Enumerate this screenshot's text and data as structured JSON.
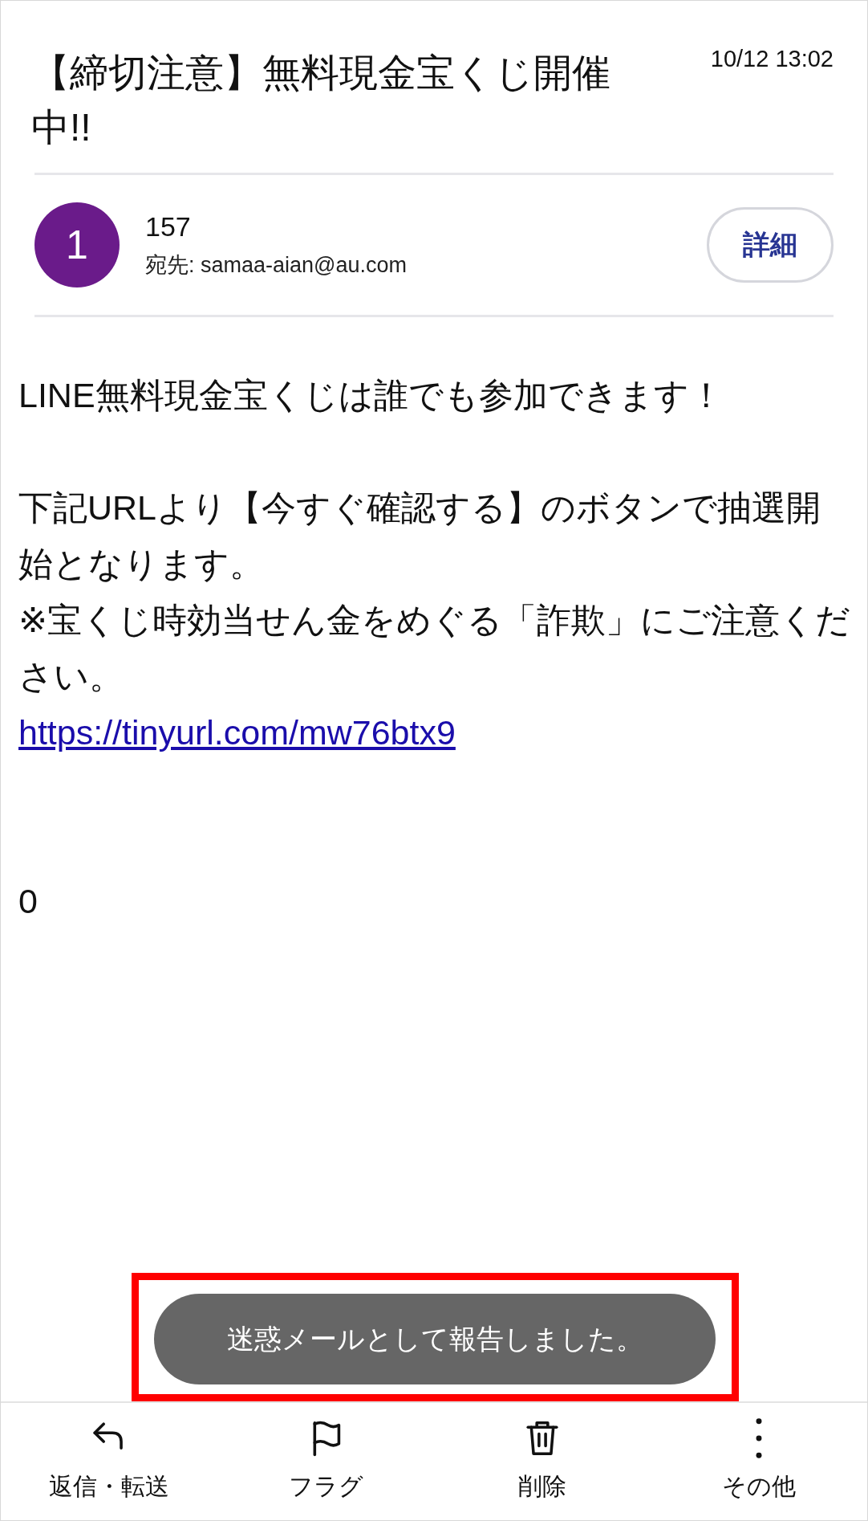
{
  "header": {
    "subject": "【締切注意】無料現金宝くじ開催中!!",
    "date": "10/12 13:02"
  },
  "sender": {
    "avatar": "1",
    "name": "157",
    "recipient": "宛先: samaa-aian@au.com",
    "details_button": "詳細"
  },
  "body": [
    {
      "kind": "text",
      "text": "LINE無料現金宝くじは誰でも参加できます！"
    },
    {
      "kind": "blank"
    },
    {
      "kind": "text",
      "text": "下記URLより【今すぐ確認する】のボタンで抽選開始となります。"
    },
    {
      "kind": "text",
      "text": "※宝くじ時効当せん金をめぐる「詐欺」にご注意ください。"
    },
    {
      "kind": "link",
      "text": "https://tinyurl.com/mw76btx9"
    },
    {
      "kind": "blank"
    },
    {
      "kind": "blank"
    },
    {
      "kind": "text",
      "text": "0"
    }
  ],
  "toast": {
    "text": "迷惑メールとして報告しました。"
  },
  "toolbar": [
    {
      "kind": "reply",
      "label": "返信・転送"
    },
    {
      "kind": "flag",
      "label": "フラグ"
    },
    {
      "kind": "trash",
      "label": "削除"
    },
    {
      "kind": "more",
      "label": "その他"
    }
  ]
}
